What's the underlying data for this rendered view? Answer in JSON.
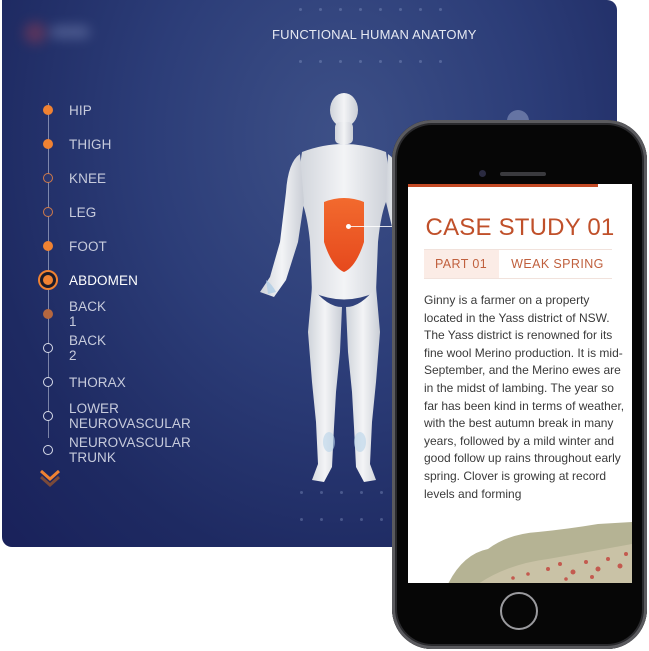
{
  "panel": {
    "title": "FUNCTIONAL HUMAN ANATOMY",
    "nav_items": [
      {
        "label": "HIP",
        "state": "done"
      },
      {
        "label": "THIGH",
        "state": "done"
      },
      {
        "label": "KNEE",
        "state": "hollow-orange"
      },
      {
        "label": "LEG",
        "state": "hollow-orange"
      },
      {
        "label": "FOOT",
        "state": "done"
      },
      {
        "label": "ABDOMEN",
        "state": "active"
      },
      {
        "label": "BACK 1",
        "state": "dim"
      },
      {
        "label": "BACK 2",
        "state": "hollow"
      },
      {
        "label": "THORAX",
        "state": "hollow"
      },
      {
        "label": "LOWER NEUROVASCULAR",
        "state": "hollow"
      },
      {
        "label": "NEUROVASCULAR TRUNK",
        "state": "hollow"
      }
    ],
    "more_icon": "double-chevron-down-icon",
    "highlighted_region": "abdomen",
    "colors": {
      "accent": "#f08232",
      "panel": "#2c3d78"
    }
  },
  "phone": {
    "case_title": "CASE STUDY 01",
    "tabs": [
      {
        "label": "PART 01"
      },
      {
        "label": "WEAK SPRING"
      }
    ],
    "body": "Ginny is a farmer on a property located in the Yass district of NSW. The Yass district is renowned for its fine wool Merino production. It is mid-September, and the Merino ewes are in the midst of lambing. The year so far has been kind in terms of weather, with the best autumn break in many years, followed by a mild winter and good follow up rains throughout early spring. Clover is growing at record levels and forming",
    "colors": {
      "accent": "#c0502a"
    }
  }
}
